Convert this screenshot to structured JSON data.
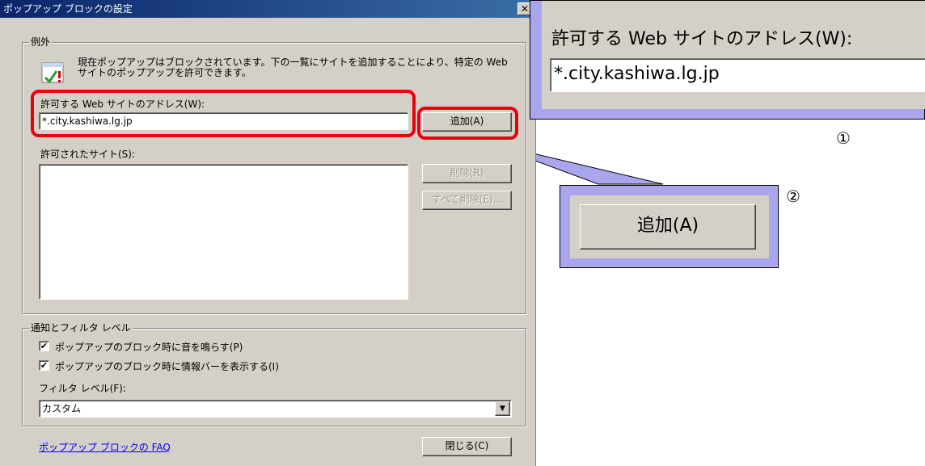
{
  "dialog": {
    "title": "ポップアップ ブロックの設定",
    "close_glyph": "✕",
    "exceptions": {
      "group_label": "例外",
      "info_text": "現在ポップアップはブロックされています。下の一覧にサイトを追加することにより、特定の Web サイトのポップアップを許可できます。",
      "address_label": "許可する Web サイトのアドレス(W):",
      "address_value": "*.city.kashiwa.lg.jp",
      "add_button": "追加(A)",
      "allowed_label": "許可されたサイト(S):",
      "allowed_sites": [],
      "remove_button": "削除(R)",
      "remove_all_button": "すべて削除(E)..."
    },
    "notifications": {
      "group_label": "通知とフィルタ レベル",
      "sound_checkbox": "ポップアップのブロック時に音を鳴らす(P)",
      "sound_checked": true,
      "infobar_checkbox": "ポップアップのブロック時に情報バーを表示する(I)",
      "infobar_checked": true,
      "filter_label": "フィルタ レベル(F):",
      "filter_value": "カスタム"
    },
    "faq_link": "ポップアップ ブロックの FAQ",
    "close_button": "閉じる(C)"
  },
  "callouts": {
    "address": {
      "label": "許可する Web サイトのアドレス(W):",
      "value": "*.city.kashiwa.lg.jp",
      "number": "①"
    },
    "add": {
      "button": "追加(A)",
      "number": "②"
    }
  },
  "colors": {
    "highlight": "#e8000b",
    "callout_fill": "#aaa6ee",
    "dialog_face": "#d4d0c8",
    "titlebar": "#0a246a"
  }
}
